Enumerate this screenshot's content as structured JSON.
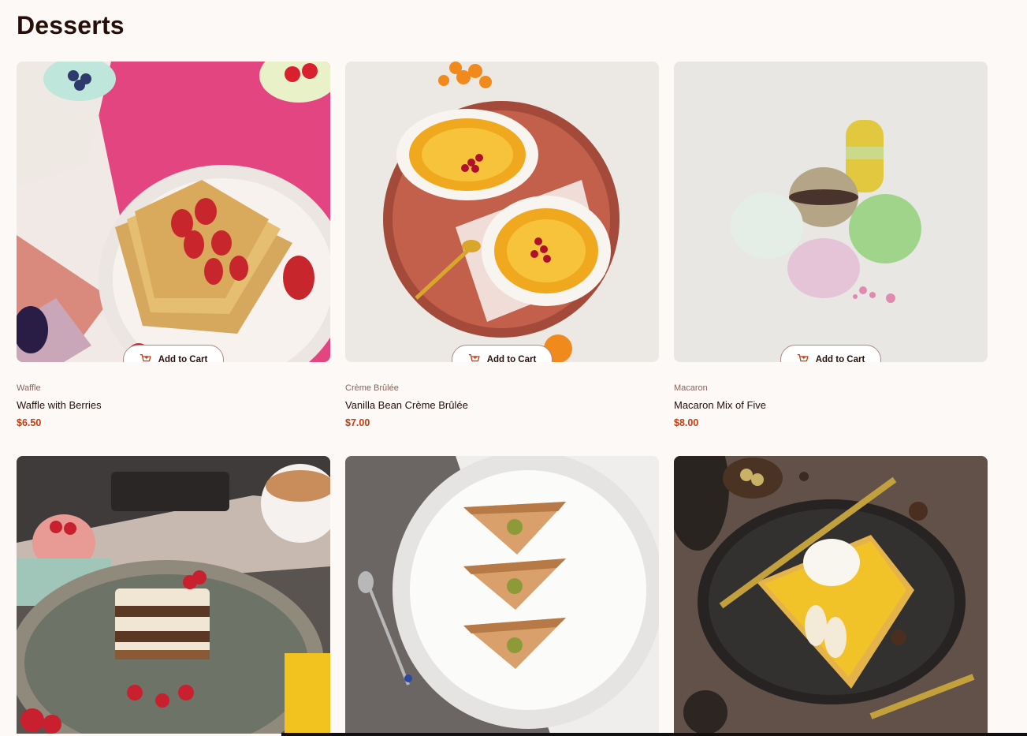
{
  "page": {
    "title": "Desserts"
  },
  "colors": {
    "background": "#fcf9f7",
    "price": "#c73b0f",
    "category": "#87635a",
    "text": "#260f08"
  },
  "products": [
    {
      "category": "Waffle",
      "name": "Waffle with Berries",
      "price": "$6.50",
      "button_label": "Add to Cart",
      "image": "waffle-with-berries-photo"
    },
    {
      "category": "Crème Brûlée",
      "name": "Vanilla Bean Crème Brûlée",
      "price": "$7.00",
      "button_label": "Add to Cart",
      "image": "creme-brulee-photo"
    },
    {
      "category": "Macaron",
      "name": "Macaron Mix of Five",
      "price": "$8.00",
      "button_label": "Add to Cart",
      "image": "macarons-photo"
    },
    {
      "image": "tiramisu-photo"
    },
    {
      "image": "baklava-photo"
    },
    {
      "image": "pie-photo"
    }
  ]
}
